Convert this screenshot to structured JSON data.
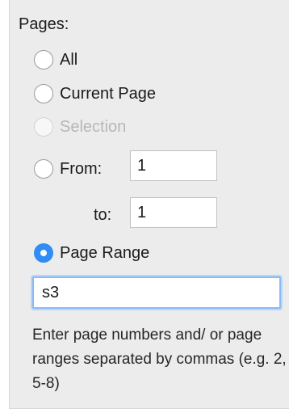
{
  "pages_section": {
    "title": "Pages:",
    "options": {
      "all": {
        "label": "All",
        "checked": false,
        "enabled": true
      },
      "current_page": {
        "label": "Current Page",
        "checked": false,
        "enabled": true
      },
      "selection": {
        "label": "Selection",
        "checked": false,
        "enabled": false
      },
      "from": {
        "label": "From:",
        "checked": false,
        "enabled": true,
        "value": "1"
      },
      "to": {
        "label": "to:",
        "value": "1"
      },
      "page_range": {
        "label": "Page Range",
        "checked": true,
        "enabled": true,
        "value": "s3"
      }
    },
    "help_text": "Enter page numbers and/ or page ranges separated by commas (e.g. 2, 5-8)"
  },
  "colors": {
    "accent": "#2f8df5",
    "panel_background": "#ececec",
    "focus_ring": "#8cbbf3"
  }
}
